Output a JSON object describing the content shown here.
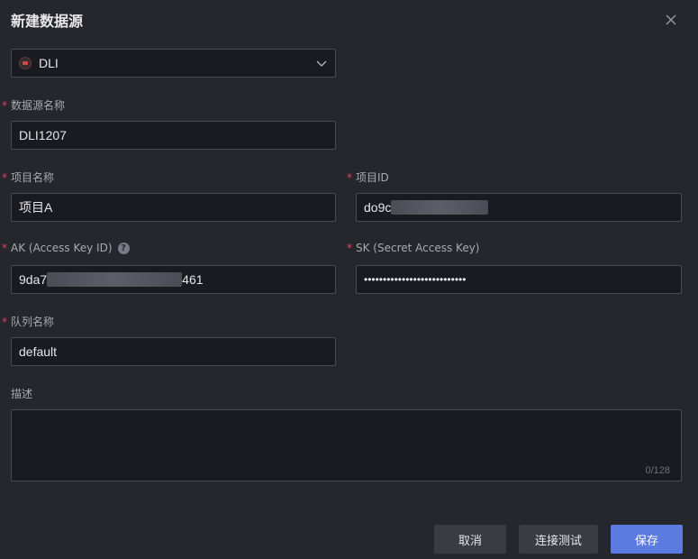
{
  "dialog": {
    "title": "新建数据源"
  },
  "source_type": {
    "value": "DLI",
    "icon": "dli-logo-icon"
  },
  "fields": {
    "name": {
      "label": "数据源名称",
      "value": "DLI1207",
      "required": true
    },
    "project_name": {
      "label": "项目名称",
      "value": "项目A",
      "required": true
    },
    "project_id": {
      "label": "项目ID",
      "value": "do9c",
      "required": true,
      "redacted": true
    },
    "ak": {
      "label": "AK (Access Key ID)",
      "value_prefix": "9da7",
      "value_suffix": "461",
      "required": true,
      "redacted": true
    },
    "sk": {
      "label": "SK (Secret Access Key)",
      "value": "•••••••••••••••••••••••••••",
      "required": true
    },
    "queue": {
      "label": "队列名称",
      "value": "default",
      "required": true
    },
    "description": {
      "label": "描述",
      "value": "",
      "counter": "0/128"
    }
  },
  "buttons": {
    "cancel": "取消",
    "test": "连接测试",
    "save": "保存"
  },
  "colors": {
    "background": "#26262d",
    "input_bg": "#1a1a21",
    "border": "#4a4a55",
    "required": "#e0455b",
    "primary": "#5b7be0"
  }
}
